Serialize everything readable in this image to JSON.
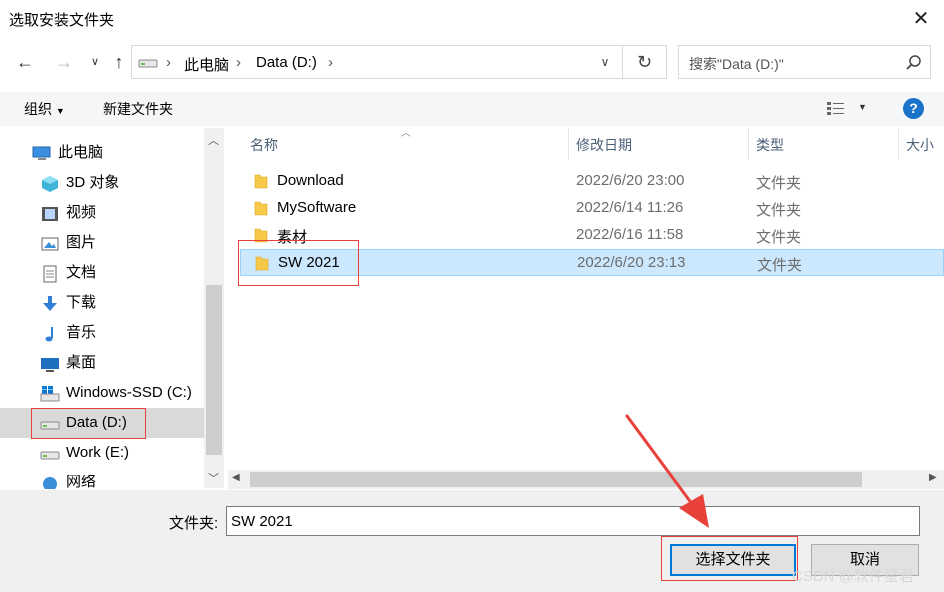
{
  "window": {
    "title": "选取安装文件夹"
  },
  "address": {
    "crumbs": [
      "此电脑",
      "Data (D:)"
    ],
    "search_placeholder": "搜索\"Data (D:)\""
  },
  "toolbar": {
    "organize": "组织",
    "new_folder": "新建文件夹"
  },
  "nav": {
    "items": [
      {
        "label": "此电脑",
        "icon": "computer-icon"
      },
      {
        "label": "3D 对象",
        "icon": "cube-icon"
      },
      {
        "label": "视频",
        "icon": "video-icon"
      },
      {
        "label": "图片",
        "icon": "picture-icon"
      },
      {
        "label": "文档",
        "icon": "document-icon"
      },
      {
        "label": "下载",
        "icon": "download-icon"
      },
      {
        "label": "音乐",
        "icon": "music-icon"
      },
      {
        "label": "桌面",
        "icon": "desktop-icon"
      },
      {
        "label": "Windows-SSD (C:)",
        "icon": "windows-drive-icon"
      },
      {
        "label": "Data (D:)",
        "icon": "drive-icon"
      },
      {
        "label": "Work (E:)",
        "icon": "drive-icon"
      },
      {
        "label": "网络",
        "icon": "network-icon"
      }
    ],
    "selected": "Data (D:)"
  },
  "columns": {
    "name": "名称",
    "date": "修改日期",
    "type": "类型",
    "size": "大小"
  },
  "files": [
    {
      "name": "Download",
      "date": "2022/6/20 23:00",
      "type": "文件夹"
    },
    {
      "name": "MySoftware",
      "date": "2022/6/14 11:26",
      "type": "文件夹"
    },
    {
      "name": "素材",
      "date": "2022/6/16 11:58",
      "type": "文件夹"
    },
    {
      "name": "SW 2021",
      "date": "2022/6/20 23:13",
      "type": "文件夹"
    }
  ],
  "selected_file": "SW 2021",
  "footer": {
    "folder_label": "文件夹:",
    "folder_value": "SW 2021",
    "select_button": "选择文件夹",
    "cancel_button": "取消"
  },
  "watermark": "CSDN @软件星君",
  "colors": {
    "selection": "#cce8ff",
    "accent": "#0078d7",
    "annotation": "#e8403a"
  }
}
